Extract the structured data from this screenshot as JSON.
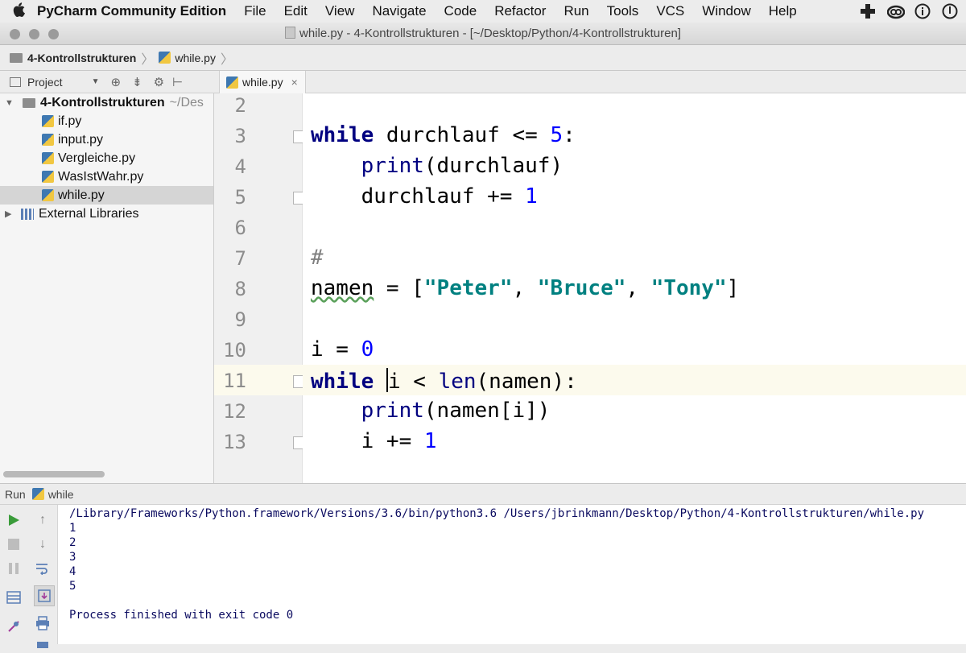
{
  "menubar": {
    "apple": "",
    "app_name": "PyCharm Community Edition",
    "items": [
      "File",
      "Edit",
      "View",
      "Navigate",
      "Code",
      "Refactor",
      "Run",
      "Tools",
      "VCS",
      "Window",
      "Help"
    ]
  },
  "window": {
    "title": "while.py - 4-Kontrollstrukturen - [~/Desktop/Python/4-Kontrollstrukturen]"
  },
  "breadcrumb": {
    "folder": "4-Kontrollstrukturen",
    "file": "while.py"
  },
  "project_panel": {
    "label": "Project",
    "root": "4-Kontrollstrukturen",
    "root_path": "~/Des",
    "files": [
      "if.py",
      "input.py",
      "Vergleiche.py",
      "WasIstWahr.py",
      "while.py"
    ],
    "selected_file": "while.py",
    "external": "External Libraries"
  },
  "editor": {
    "tab_label": "while.py",
    "tab_close": "×",
    "current_line": 11,
    "lines": [
      {
        "n": "2",
        "text": ""
      },
      {
        "n": "3",
        "text": "while durchlauf <= 5:"
      },
      {
        "n": "4",
        "text": "    print(durchlauf)"
      },
      {
        "n": "5",
        "text": "    durchlauf += 1"
      },
      {
        "n": "6",
        "text": ""
      },
      {
        "n": "7",
        "text": "#"
      },
      {
        "n": "8",
        "text": "namen = [\"Peter\", \"Bruce\", \"Tony\"]"
      },
      {
        "n": "9",
        "text": ""
      },
      {
        "n": "10",
        "text": "i = 0"
      },
      {
        "n": "11",
        "text": "while i < len(namen):"
      },
      {
        "n": "12",
        "text": "    print(namen[i])"
      },
      {
        "n": "13",
        "text": "    i += 1"
      }
    ]
  },
  "run_panel": {
    "label": "Run",
    "config": "while",
    "output": [
      "/Library/Frameworks/Python.framework/Versions/3.6/bin/python3.6 /Users/jbrinkmann/Desktop/Python/4-Kontrollstrukturen/while.py",
      "1",
      "2",
      "3",
      "4",
      "5",
      "",
      "Process finished with exit code 0"
    ]
  },
  "colors": {
    "keyword": "#000080",
    "number": "#0000ff",
    "string": "#008080",
    "current_line_bg": "#fcfaed",
    "run_green": "#3a9c3a"
  }
}
